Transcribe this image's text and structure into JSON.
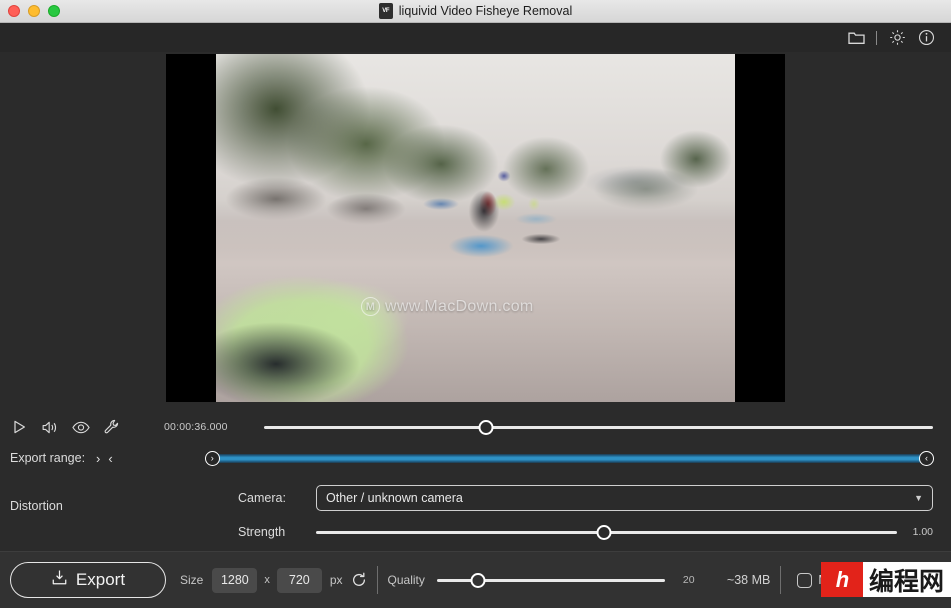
{
  "window": {
    "title": "liquivid Video Fisheye Removal",
    "app_icon_text": "VF",
    "traffic_lights": [
      "close",
      "minimize",
      "zoom"
    ]
  },
  "toolbar": {
    "items": [
      {
        "name": "open-folder-icon",
        "label": "Open"
      },
      {
        "name": "settings-gear-icon",
        "label": "Settings"
      },
      {
        "name": "info-icon",
        "label": "Info"
      }
    ]
  },
  "video": {
    "watermark_text": "www.MacDown.com",
    "watermark_logo": "M",
    "letterbox_color": "#000000"
  },
  "transport": {
    "play_label": "Play",
    "volume_label": "Volume",
    "preview_label": "Preview",
    "tools_label": "Tools",
    "timecode": "00:00:36.000",
    "timeline_position_percent": 33.2
  },
  "export_range": {
    "label": "Export range:",
    "arrow_in": "›",
    "arrow_out": "‹",
    "start_handle": "›",
    "end_handle": "‹",
    "bar_color": "#2f92c6"
  },
  "distortion": {
    "section_title": "Distortion",
    "camera_label": "Camera:",
    "camera_value": "Other / unknown camera",
    "camera_caret": "▼",
    "strength_label": "Strength",
    "strength_value": "1.00",
    "strength_position_percent": 49.5
  },
  "export_bar": {
    "export_label": "Export",
    "size_label": "Size",
    "width_value": "1280",
    "height_value": "720",
    "x_separator": "x",
    "px_label": "px",
    "reset_label": "Reset size",
    "quality_label": "Quality",
    "quality_value": "20",
    "quality_position_percent": 18,
    "filesize_estimate": "~38 MB",
    "format_label": "M",
    "format_checked": false
  },
  "site_watermark": {
    "mark_text": "h",
    "text": "编程网",
    "mark_color": "#e2231a"
  }
}
